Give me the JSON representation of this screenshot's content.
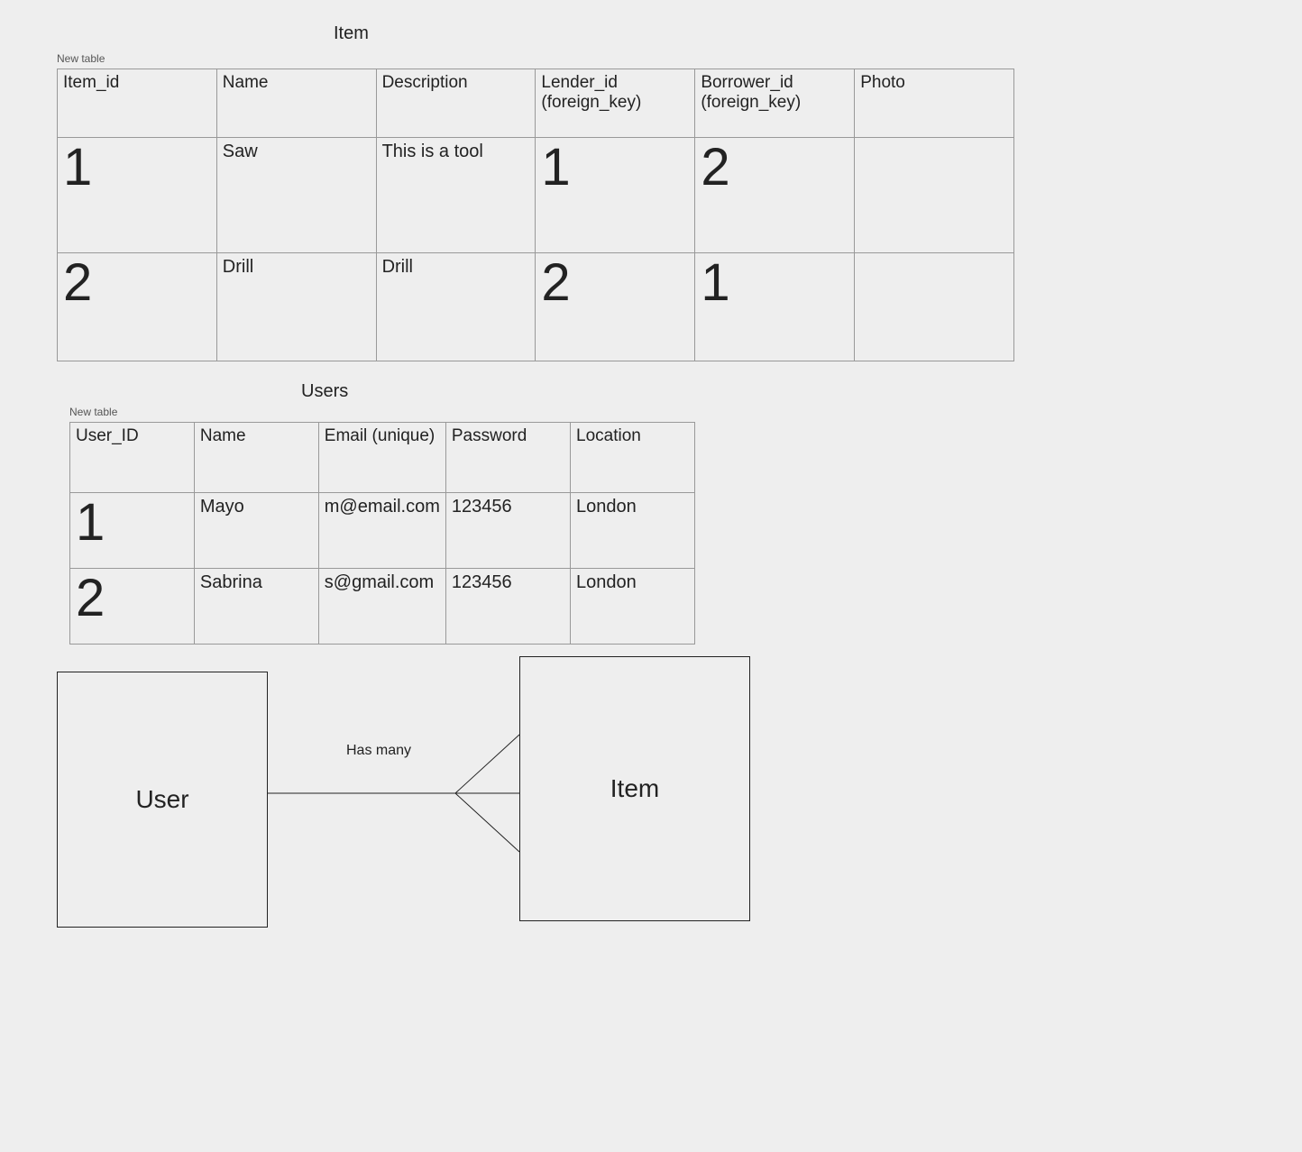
{
  "item_table": {
    "title": "Item",
    "new_label": "New table",
    "columns": [
      "Item_id",
      "Name",
      "Description",
      "Lender_id (foreign_key)",
      "Borrower_id (foreign_key)",
      "Photo"
    ],
    "rows": [
      {
        "item_id": "1",
        "name": "Saw",
        "description": "This is a tool",
        "lender_id": "1",
        "borrower_id": "2",
        "photo": ""
      },
      {
        "item_id": "2",
        "name": "Drill",
        "description": "Drill",
        "lender_id": "2",
        "borrower_id": "1",
        "photo": ""
      }
    ]
  },
  "users_table": {
    "title": "Users",
    "new_label": "New table",
    "columns": [
      "User_ID",
      "Name",
      "Email  (unique)",
      "Password",
      "Location"
    ],
    "rows": [
      {
        "user_id": "1",
        "name": "Mayo",
        "email": "m@email.com",
        "password": "123456",
        "location": "London"
      },
      {
        "user_id": "2",
        "name": "Sabrina",
        "email": "s@gmail.com",
        "password": "123456",
        "location": "London"
      }
    ]
  },
  "erd": {
    "user_box": "User",
    "item_box": "Item",
    "relation_label": "Has many"
  }
}
